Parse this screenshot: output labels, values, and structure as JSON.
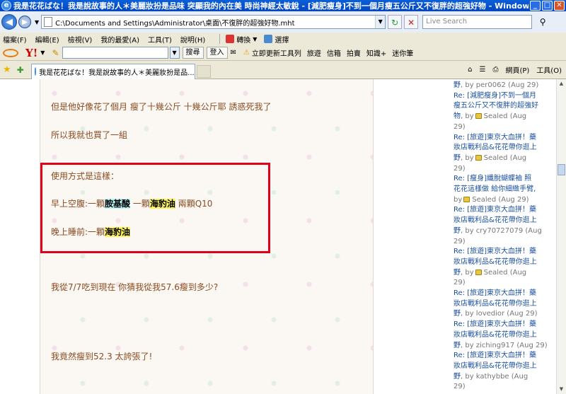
{
  "window": {
    "title": "我是花花ばな！我是說故事的人＊美麗妝扮是品味 突顯我的內在美 時尚神經太敏銳 - [減肥瘦身]不到一個月瘦五公斤又不復胖的超強好物 - Windows Internet E...",
    "minimize": "_",
    "maximize": "□",
    "close": "✕"
  },
  "address": {
    "url": "C:\\Documents and Settings\\Administrator\\桌面\\不復胖的超強好物.mht",
    "search_placeholder": "Live Search"
  },
  "menu": {
    "items": [
      "檔案(F)",
      "編輯(E)",
      "檢視(V)",
      "我的最愛(A)",
      "工具(T)",
      "說明(H)"
    ],
    "convert": "轉換",
    "select": "選擇"
  },
  "yahoo": {
    "logo": "Y!",
    "search_btn": "搜尋",
    "login_btn": "登入",
    "links": [
      "立即更新工具列",
      "旅遊",
      "信箱",
      "拍賣",
      "知識+",
      "迷你筆"
    ]
  },
  "tabs": {
    "active_label": "我是花花ばな！我是說故事的人＊美麗妝扮是品...",
    "tools": [
      "網頁(P)",
      "工具(O)"
    ]
  },
  "post": {
    "line1": "但是他好像花了個月 瘦了十幾公斤 十幾公斤耶 誘惑死我了",
    "line2": "所以我就也買了一組",
    "usage_title": "使用方式是這樣：",
    "morning_prefix": "早上空腹:一顆",
    "morning_hl1": "胺基酸",
    "morning_mid": " 一顆",
    "morning_hl2": "海豹油",
    "morning_suffix": " 兩顆Q10",
    "night_prefix": "晚上睡前:一顆",
    "night_hl": "海豹油",
    "line_weight": "我從7/7吃到現在 你猜我從我57.6瘦到多少?",
    "line_result": "我竟然瘦到52.3 太誇張了!"
  },
  "sidebar": {
    "lines": [
      {
        "link": "野",
        "meta": ", by per0062 (Aug 29)"
      },
      {
        "link": "Re: [減肥瘦身]不到一個月",
        "meta": ""
      },
      {
        "link": "瘦五公斤又不復胖的超強好",
        "meta": ""
      },
      {
        "link": "物",
        "meta": ", by",
        "lock": true,
        "after": "Sealed (Aug"
      },
      {
        "link": "",
        "meta": "29)"
      },
      {
        "link": "Re: [旅遊]東京大血拼！藥",
        "meta": ""
      },
      {
        "link": "妝店戰利品&花花帶你逛上",
        "meta": ""
      },
      {
        "link": "野",
        "meta": ", by",
        "lock": true,
        "after": "Sealed (Aug"
      },
      {
        "link": "",
        "meta": "29)"
      },
      {
        "link": "Re: [瘦身]纖脫蝴蝶袖 照",
        "meta": ""
      },
      {
        "link": "花花這樣做 給你細緻手臂,",
        "meta": ""
      },
      {
        "link": "",
        "meta": "by",
        "lock": true,
        "after": "Sealed (Aug 29)"
      },
      {
        "link": "Re: [旅遊]東京大血拼！藥",
        "meta": ""
      },
      {
        "link": "妝店戰利品&花花帶你逛上",
        "meta": ""
      },
      {
        "link": "野",
        "meta": ", by cry70727079 (Aug"
      },
      {
        "link": "",
        "meta": "29)"
      },
      {
        "link": "Re: [旅遊]東京大血拼！藥",
        "meta": ""
      },
      {
        "link": "妝店戰利品&花花帶你逛上",
        "meta": ""
      },
      {
        "link": "野",
        "meta": ", by",
        "lock": true,
        "after": "Sealed (Aug"
      },
      {
        "link": "",
        "meta": "29)"
      },
      {
        "link": "Re: [旅遊]東京大血拼！藥",
        "meta": ""
      },
      {
        "link": "妝店戰利品&花花帶你逛上",
        "meta": ""
      },
      {
        "link": "野",
        "meta": ", by lovedior (Aug 29)"
      },
      {
        "link": "Re: [旅遊]東京大血拼！藥",
        "meta": ""
      },
      {
        "link": "妝店戰利品&花花帶你逛上",
        "meta": ""
      },
      {
        "link": "野",
        "meta": ", by ziching917 (Aug 29)"
      },
      {
        "link": "Re: [旅遊]東京大血拼！藥",
        "meta": ""
      },
      {
        "link": "妝店戰利品&花花帶你逛上",
        "meta": ""
      },
      {
        "link": "野",
        "meta": ", by kathybbe (Aug"
      },
      {
        "link": "",
        "meta": "29)"
      }
    ]
  },
  "colors": {
    "post_text": "#8a4b1f",
    "highlight_box": "#e0001a",
    "link": "#1a4f9e"
  }
}
